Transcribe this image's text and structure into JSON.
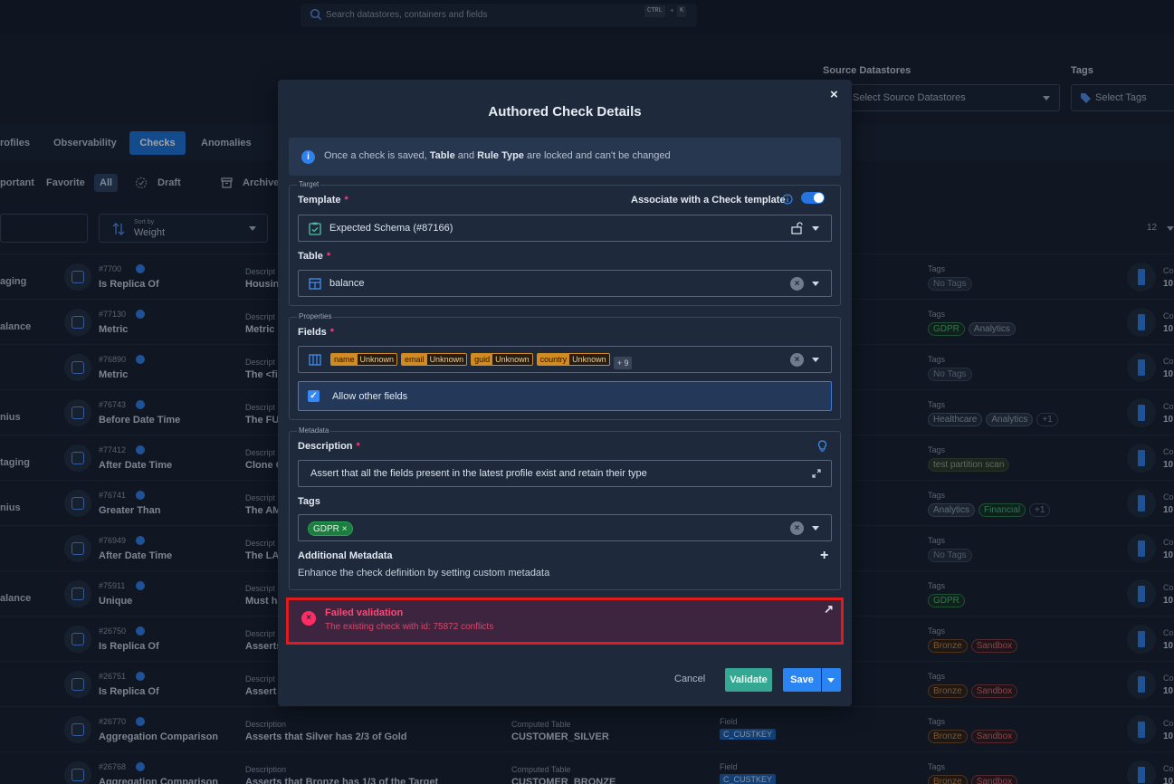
{
  "search": {
    "placeholder": "Search datastores, containers and fields",
    "kbd_ctrl": "CTRL",
    "kbd_plus": "+",
    "kbd_k": "K"
  },
  "filters": {
    "source_label": "Source Datastores",
    "source_placeholder": "Select Source Datastores",
    "tags_label": "Tags",
    "tags_placeholder": "Select Tags"
  },
  "tabs": [
    "rofiles",
    "Observability",
    "Checks",
    "Anomalies"
  ],
  "chips": {
    "important": "portant",
    "favorite": "Favorite",
    "all": "All",
    "draft": "Draft",
    "archived": "Archive"
  },
  "sort": {
    "label": "Sort by",
    "value": "Weight"
  },
  "page_count": "12",
  "rows": [
    {
      "left": "aging",
      "id": "#7700",
      "name": "Is Replica Of",
      "dlabel": "Descript",
      "dvalue": "Housin",
      "tags_label": "Tags",
      "tags": [
        {
          "t": "No Tags",
          "k": "none"
        }
      ],
      "rlabel": "Co",
      "rvalue": "10"
    },
    {
      "left": "alance",
      "id": "#77130",
      "name": "Metric",
      "dlabel": "Descript",
      "dvalue": "Metric",
      "tags_label": "Tags",
      "tags": [
        {
          "t": "GDPR",
          "k": "gdpr"
        },
        {
          "t": "Analytics",
          "k": "anal"
        }
      ],
      "rlabel": "Co",
      "rvalue": "10"
    },
    {
      "left": "",
      "id": "#76890",
      "name": "Metric",
      "dlabel": "Descript",
      "dvalue": "The <fi",
      "tags_label": "Tags",
      "tags": [
        {
          "t": "No Tags",
          "k": "none"
        }
      ],
      "rlabel": "Co",
      "rvalue": "10"
    },
    {
      "left": "nius",
      "id": "#76743",
      "name": "Before Date Time",
      "dlabel": "Descript",
      "dvalue": "The FUI",
      "tags_label": "Tags",
      "tags": [
        {
          "t": "Healthcare",
          "k": "hc"
        },
        {
          "t": "Analytics",
          "k": "anal"
        },
        {
          "t": "+1",
          "k": "plus"
        }
      ],
      "rlabel": "Co",
      "rvalue": "10"
    },
    {
      "left": "taging",
      "id": "#77412",
      "name": "After Date Time",
      "dlabel": "Descript",
      "dvalue": "Clone C",
      "tags_label": "Tags",
      "tags": [
        {
          "t": "test partition scan",
          "k": "tps"
        }
      ],
      "rlabel": "Co",
      "rvalue": "10"
    },
    {
      "left": "nius",
      "id": "#76741",
      "name": "Greater Than",
      "dlabel": "Descript",
      "dvalue": "The AM",
      "tags_label": "Tags",
      "tags": [
        {
          "t": "Analytics",
          "k": "anal"
        },
        {
          "t": "Financial",
          "k": "fin"
        },
        {
          "t": "+1",
          "k": "plus"
        }
      ],
      "rlabel": "Co",
      "rvalue": "10"
    },
    {
      "left": "",
      "id": "#76949",
      "name": "After Date Time",
      "dlabel": "Descript",
      "dvalue": "The LAS",
      "tags_label": "Tags",
      "tags": [
        {
          "t": "No Tags",
          "k": "none"
        }
      ],
      "rlabel": "Co",
      "rvalue": "10"
    },
    {
      "left": "alance",
      "id": "#75911",
      "name": "Unique",
      "dlabel": "Descript",
      "dvalue": "Must ha",
      "tags_label": "Tags",
      "tags": [
        {
          "t": "GDPR",
          "k": "gdpr"
        }
      ],
      "rlabel": "Co",
      "rvalue": "10"
    },
    {
      "left": "",
      "id": "#26750",
      "name": "Is Replica Of",
      "dlabel": "Descript",
      "dvalue": "Asserts",
      "tags_label": "Tags",
      "tags": [
        {
          "t": "Bronze",
          "k": "brz"
        },
        {
          "t": "Sandbox",
          "k": "sbx"
        }
      ],
      "rlabel": "Co",
      "rvalue": "10"
    },
    {
      "left": "",
      "id": "#26751",
      "name": "Is Replica Of",
      "dlabel": "Descript",
      "dvalue": "Assert t",
      "tags_label": "Tags",
      "tags": [
        {
          "t": "Bronze",
          "k": "brz"
        },
        {
          "t": "Sandbox",
          "k": "sbx"
        }
      ],
      "rlabel": "Co",
      "rvalue": "10"
    },
    {
      "left": "",
      "id": "#26770",
      "name": "Aggregation Comparison",
      "dlabel": "Description",
      "dvalue": "Asserts that Silver has 2/3 of Gold",
      "ctlabel": "Computed Table",
      "ctvalue": "CUSTOMER_SILVER",
      "fdlabel": "Field",
      "fdvalue": "C_CUSTKEY",
      "tags_label": "Tags",
      "tags": [
        {
          "t": "Bronze",
          "k": "brz"
        },
        {
          "t": "Sandbox",
          "k": "sbx"
        }
      ],
      "rlabel": "Co",
      "rvalue": "10"
    },
    {
      "left": "",
      "id": "#26768",
      "name": "Aggregation Comparison",
      "dlabel": "Description",
      "dvalue": "Asserts that Bronze has 1/3 of the Target",
      "ctlabel": "Computed Table",
      "ctvalue": "CUSTOMER_BRONZE",
      "fdlabel": "Field",
      "fdvalue": "C_CUSTKEY",
      "tags_label": "Tags",
      "tags": [
        {
          "t": "Bronze",
          "k": "brz"
        },
        {
          "t": "Sandbox",
          "k": "sbx"
        }
      ],
      "rlabel": "Co",
      "rvalue": "10"
    }
  ],
  "modal": {
    "title": "Authored Check Details",
    "close": "×",
    "info": {
      "pre": "Once a check is saved, ",
      "b1": "Table",
      "mid": " and ",
      "b2": "Rule Type",
      "post": " are locked and can't be changed"
    },
    "target": {
      "legend": "Target",
      "template_label": "Template",
      "required_mark": "*",
      "associate_label": "Associate with a Check template",
      "template_value": "Expected Schema (#87166)",
      "table_label": "Table",
      "table_value": "balance"
    },
    "properties": {
      "legend": "Properties",
      "fields_label": "Fields",
      "fields": [
        {
          "name": "name",
          "type": "Unknown"
        },
        {
          "name": "email",
          "type": "Unknown"
        },
        {
          "name": "guid",
          "type": "Unknown"
        },
        {
          "name": "country",
          "type": "Unknown"
        }
      ],
      "fields_more": "+ 9",
      "allow_label": "Allow other fields",
      "allow_checked": "✓"
    },
    "metadata": {
      "legend": "Metadata",
      "description_label": "Description",
      "description_value": "Assert that all the fields present in the latest profile exist and retain their type",
      "tags_label": "Tags",
      "tag": "GDPR",
      "tag_remove": "×",
      "additional_label": "Additional Metadata",
      "additional_desc": "Enhance the check definition by setting custom metadata",
      "add": "+"
    },
    "error": {
      "title": "Failed validation",
      "detail": "The existing check with id: 75872 conflicts",
      "icon": "×",
      "open": "↗"
    },
    "buttons": {
      "cancel": "Cancel",
      "validate": "Validate",
      "save": "Save"
    }
  },
  "colors": {
    "accent": "#2a84f2",
    "error": "#ff4670",
    "validate": "#34a893",
    "field_chip": "#d18b24"
  }
}
